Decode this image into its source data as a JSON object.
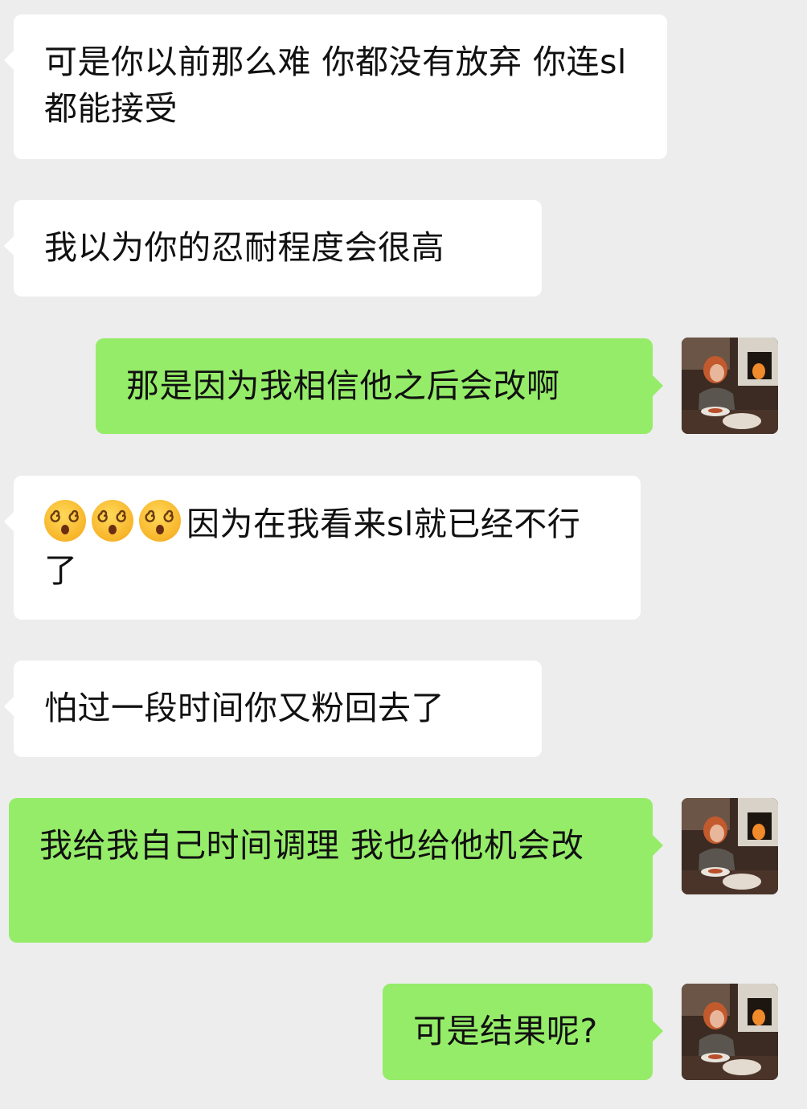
{
  "conversation": {
    "messages": [
      {
        "side": "received",
        "text": "可是你以前那么难 你都没有放弃 你连sl都能接受"
      },
      {
        "side": "received",
        "text": "我以为你的忍耐程度会很高"
      },
      {
        "side": "sent",
        "text": "那是因为我相信他之后会改啊"
      },
      {
        "side": "received",
        "emoji": [
          "dizzy-face-emoji",
          "dizzy-face-emoji",
          "dizzy-face-emoji"
        ],
        "text": "因为在我看来sl就已经不行了"
      },
      {
        "side": "received",
        "text": "怕过一段时间你又粉回去了"
      },
      {
        "side": "sent",
        "text": "我给我自己时间调理 我也给他机会改"
      },
      {
        "side": "sent",
        "text": "可是结果呢?"
      }
    ]
  },
  "colors": {
    "background": "#ededed",
    "received_bubble": "#ffffff",
    "sent_bubble": "#95ec69",
    "text": "#111111"
  }
}
